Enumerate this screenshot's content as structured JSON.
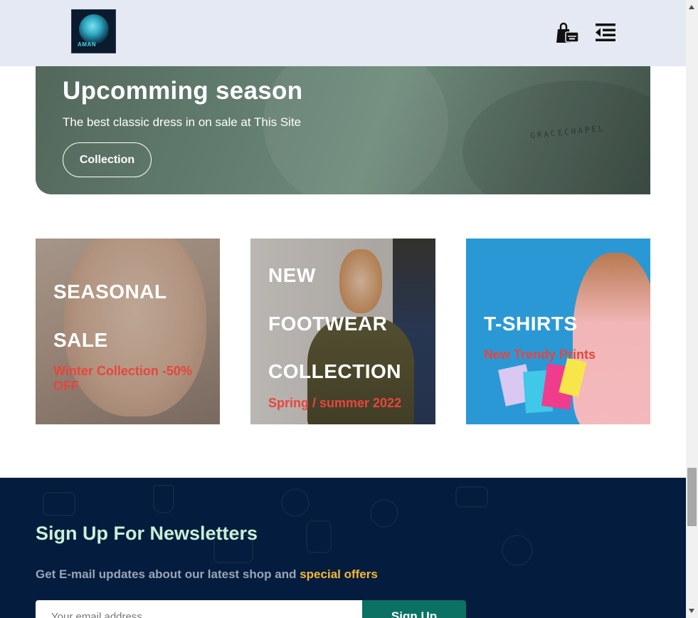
{
  "header": {
    "logo_text": "AMAN",
    "cart_icon": "shopping-bag-icon",
    "menu_icon": "menu-collapse-icon"
  },
  "hero": {
    "title": "Upcomming season",
    "subtitle": "The best classic dress in on sale at This Site",
    "button_label": "Collection",
    "shirt_tag": "GRACECHAPEL"
  },
  "cards": [
    {
      "title_lines": [
        "SEASONAL",
        "SALE"
      ],
      "subtitle": "Winter Collection -50% OFF"
    },
    {
      "title_lines": [
        "NEW",
        "FOOTWEAR",
        "COLLECTION"
      ],
      "subtitle": "Spring / summer 2022"
    },
    {
      "title_lines": [
        "T-SHIRTS"
      ],
      "subtitle": "New Trendy Prints"
    }
  ],
  "newsletter": {
    "title": "Sign Up For Newsletters",
    "description_prefix": "Get E-mail updates about our latest shop and ",
    "description_highlight": "special offers",
    "input_placeholder": "Your email address",
    "button_label": "Sign Up"
  },
  "colors": {
    "header_bg": "#e5e9f3",
    "accent_red": "#e8453c",
    "newsletter_bg": "#041c3d",
    "newsletter_title": "#c9efd8",
    "highlight": "#f7b733",
    "signup_button": "#0b7263"
  }
}
